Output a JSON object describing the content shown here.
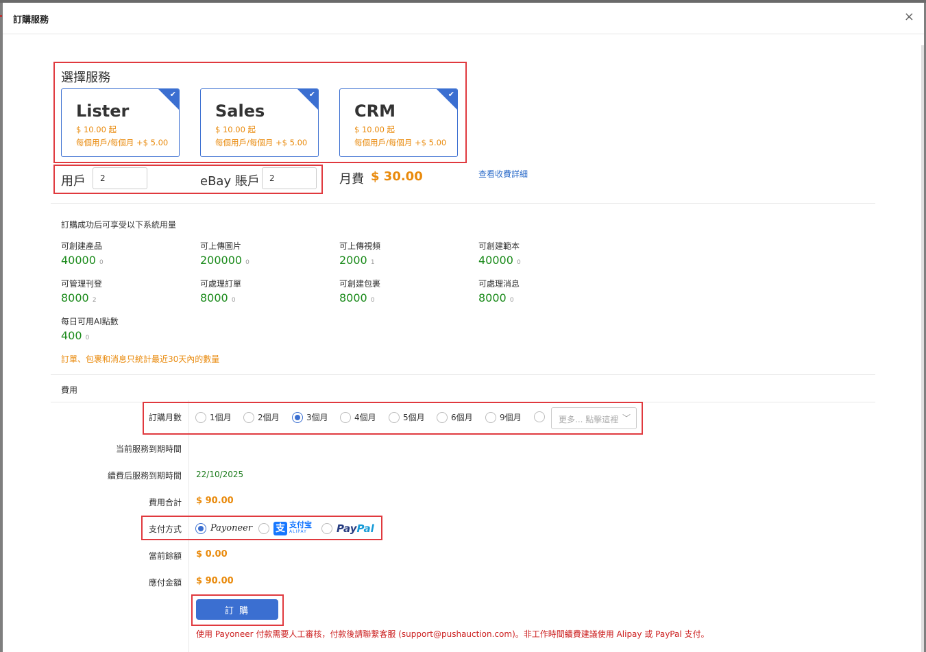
{
  "modal": {
    "title": "訂購服務",
    "close_glyph": "×"
  },
  "services": {
    "section_title": "選擇服務",
    "cards": [
      {
        "name": "Lister",
        "price": "$ 10.00 起",
        "per_user": "每個用戶/每個月 +$ 5.00",
        "selected": true
      },
      {
        "name": "Sales",
        "price": "$ 10.00 起",
        "per_user": "每個用戶/每個月 +$ 5.00",
        "selected": true
      },
      {
        "name": "CRM",
        "price": "$ 10.00 起",
        "per_user": "每個用戶/每個月 +$ 5.00",
        "selected": true
      }
    ]
  },
  "accounts": {
    "users_label": "用戶",
    "users_value": "2",
    "ebay_label": "eBay 賬戶",
    "ebay_value": "2",
    "monthly_label": "月費",
    "monthly_value": "$ 30.00",
    "details_link": "查看收費詳細"
  },
  "quota": {
    "intro": "訂購成功后可享受以下系統用量",
    "items": [
      {
        "label": "可創建產品",
        "value": "40000",
        "used": "0"
      },
      {
        "label": "可上傳圖片",
        "value": "200000",
        "used": "0"
      },
      {
        "label": "可上傳視頻",
        "value": "2000",
        "used": "1"
      },
      {
        "label": "可創建範本",
        "value": "40000",
        "used": "0"
      },
      {
        "label": "可管理刊登",
        "value": "8000",
        "used": "2"
      },
      {
        "label": "可處理訂單",
        "value": "8000",
        "used": "0"
      },
      {
        "label": "可創建包裹",
        "value": "8000",
        "used": "0"
      },
      {
        "label": "可處理消息",
        "value": "8000",
        "used": "0"
      },
      {
        "label": "每日可用AI點數",
        "value": "400",
        "used": "0"
      }
    ],
    "note": "訂單、包裹和消息只統計最近30天內的數量"
  },
  "fees": {
    "section_title": "費用",
    "months_label": "訂購月數",
    "month_options": [
      "1個月",
      "2個月",
      "3個月",
      "4個月",
      "5個月",
      "6個月",
      "9個月"
    ],
    "selected_month": "3個月",
    "more_placeholder": "更多... 點擊這裡",
    "current_expiry_label": "当前服務到期時間",
    "current_expiry_value": "",
    "renew_expiry_label": "續費后服務到期時間",
    "renew_expiry_value": "22/10/2025",
    "total_label": "費用合計",
    "total_value": "$ 90.00",
    "payment_label": "支付方式",
    "payment_methods": [
      {
        "name": "Payoneer",
        "selected": true
      },
      {
        "name": "支付宝",
        "sub": "ALIPAY",
        "selected": false
      },
      {
        "name": "PayPal",
        "selected": false
      }
    ],
    "balance_label": "當前餘額",
    "balance_value": "$ 0.00",
    "due_label": "應付金額",
    "due_value": "$ 90.00",
    "order_button": "訂 購",
    "payoneer_note": "使用 Payoneer 付款需要人工審核，付款後請聯繫客服 (support@pushauction.com)。非工作時間續費建議使用 Alipay 或 PayPal 支付。"
  },
  "colors": {
    "accent": "#3b6fd1",
    "orange": "#e98a0c",
    "green": "#1a8a1a",
    "red": "#cc1f1f",
    "highlight": "#e0393e"
  }
}
